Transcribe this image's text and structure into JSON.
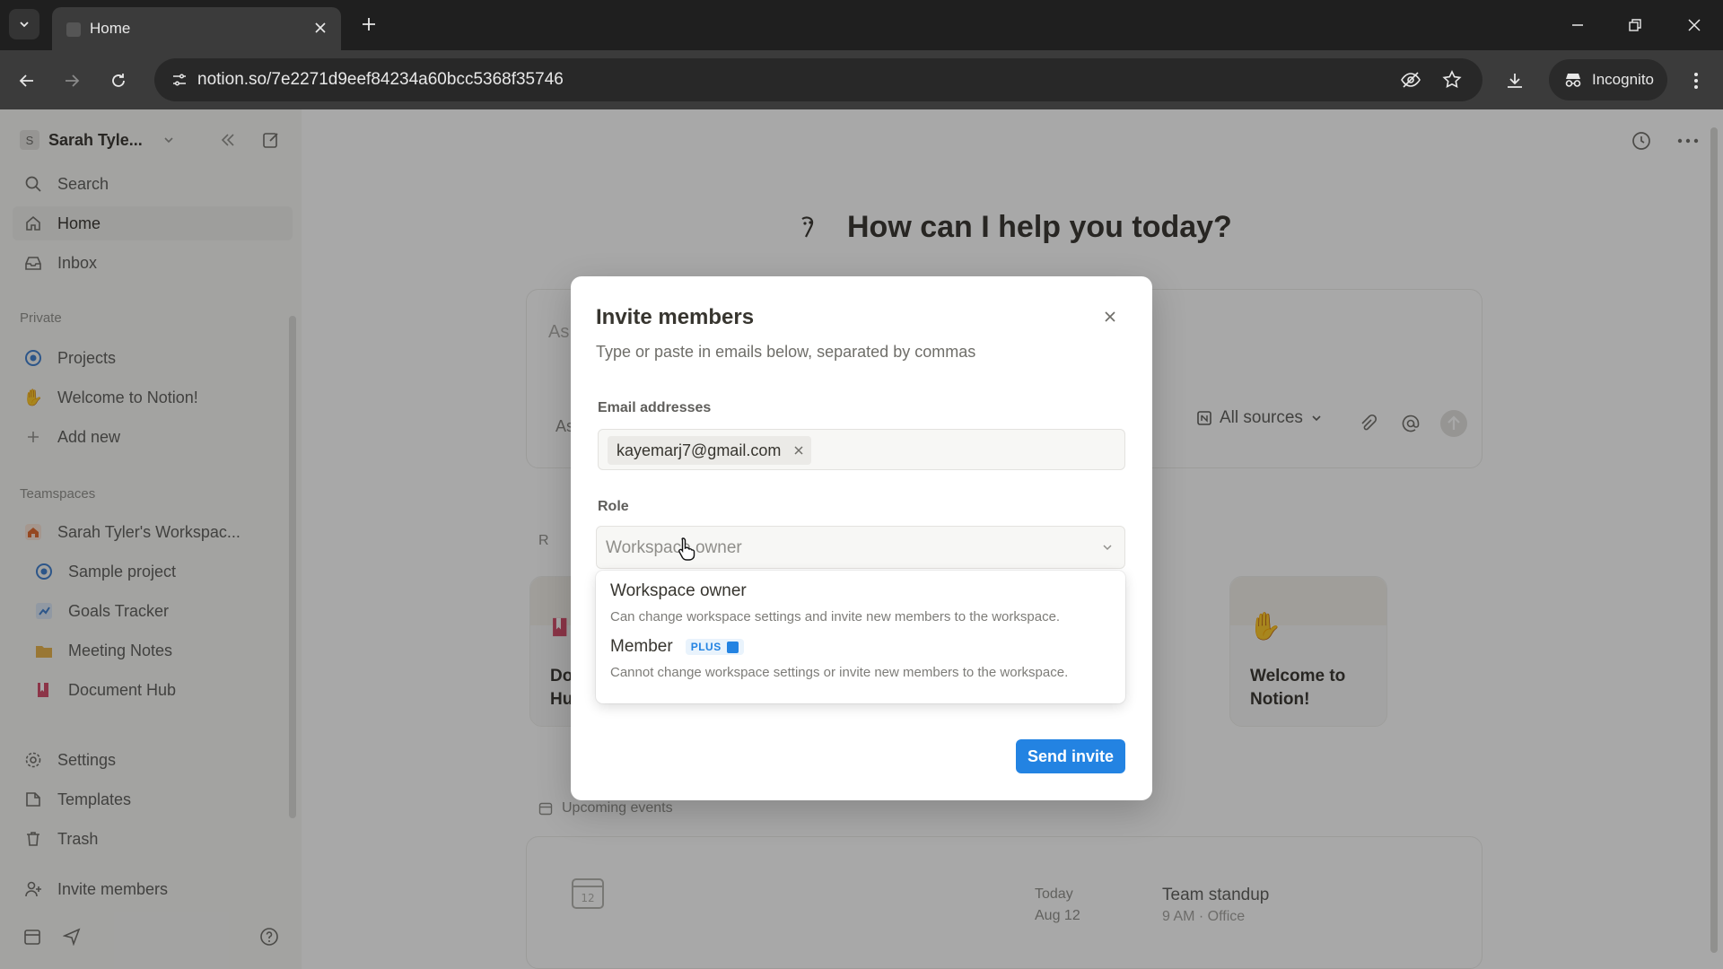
{
  "browser": {
    "tab_title": "Home",
    "url": "notion.so/7e2271d9eef84234a60bcc5368f35746",
    "incognito_label": "Incognito"
  },
  "sidebar": {
    "workspace_initial": "S",
    "workspace_name": "Sarah Tyle...",
    "nav": [
      {
        "label": "Search",
        "icon": "search-icon"
      },
      {
        "label": "Home",
        "icon": "home-icon"
      },
      {
        "label": "Inbox",
        "icon": "inbox-icon"
      }
    ],
    "private_section": "Private",
    "private_items": [
      {
        "label": "Projects",
        "icon": "projects-icon"
      },
      {
        "label": "Welcome to Notion!",
        "icon": "wave-icon"
      },
      {
        "label": "Add new",
        "icon": "plus-icon"
      }
    ],
    "teamspaces_section": "Teamspaces",
    "teamspace_name": "Sarah Tyler's Workspac...",
    "teamspace_items": [
      {
        "label": "Sample project",
        "icon": "target-icon"
      },
      {
        "label": "Goals Tracker",
        "icon": "chart-icon"
      },
      {
        "label": "Meeting Notes",
        "icon": "folder-icon"
      },
      {
        "label": "Document Hub",
        "icon": "book-icon"
      }
    ],
    "bottom_items": [
      {
        "label": "Settings",
        "icon": "gear-icon"
      },
      {
        "label": "Templates",
        "icon": "templates-icon"
      },
      {
        "label": "Trash",
        "icon": "trash-icon"
      }
    ],
    "invite_label": "Invite members"
  },
  "main": {
    "greeting": "How can I help you today?",
    "ask_placeholder_partial": "As",
    "ask_secondary_partial": "As",
    "sources_label": "All sources",
    "recent_label_partial": "R",
    "cards": [
      {
        "title": "Do\nHu"
      },
      {
        "title": "Welcome to Notion!"
      }
    ],
    "upcoming_label": "Upcoming events",
    "event": {
      "day": "Today",
      "date": "Aug 12",
      "title": "Team standup",
      "sub": "9 AM · Office"
    }
  },
  "modal": {
    "title": "Invite members",
    "subtitle": "Type or paste in emails below, separated by commas",
    "email_label": "Email addresses",
    "email_chip": "kayemarj7@gmail.com",
    "role_label": "Role",
    "role_value": "Workspace owner",
    "options": [
      {
        "title": "Workspace owner",
        "desc": "Can change workspace settings and invite new members to the workspace."
      },
      {
        "title": "Member",
        "badge": "PLUS",
        "desc": "Cannot change workspace settings or invite new members to the workspace."
      }
    ],
    "send_label": "Send invite"
  },
  "colors": {
    "accent": "#2383e2",
    "sidebar_bg": "#f7f7f5",
    "chrome_dark": "#1f1f1f"
  }
}
